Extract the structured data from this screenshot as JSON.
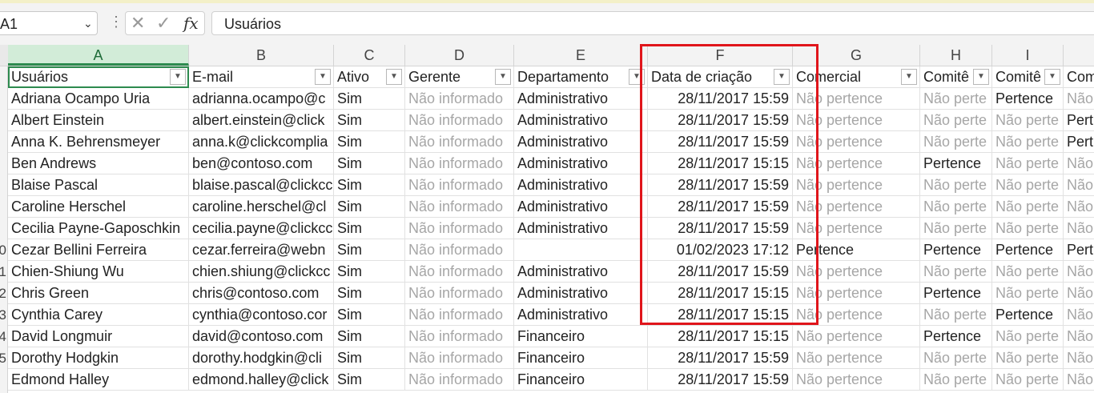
{
  "formula_bar": {
    "name_box": "A1",
    "cancel_glyph": "✕",
    "enter_glyph": "✓",
    "fx_label": "fx",
    "formula_value": "Usuários"
  },
  "columns": [
    "A",
    "B",
    "C",
    "D",
    "E",
    "F",
    "G",
    "H",
    "I",
    ""
  ],
  "row_numbers": [
    "",
    "",
    "",
    "",
    "",
    "",
    "",
    "",
    "0",
    "1",
    "2",
    "3",
    "4",
    "5"
  ],
  "headers": [
    "Usuários",
    "E-mail",
    "Ativo",
    "Gerente",
    "Departamento",
    "Data de criação",
    "Comercial",
    "Comitê",
    "Comitê",
    "Com"
  ],
  "rows": [
    [
      "Adriana Ocampo Uria",
      "adrianna.ocampo@c",
      "Sim",
      "Não informado",
      "Administrativo",
      "28/11/2017 15:59",
      "Não pertence",
      "Não perte",
      "Pertence",
      "Não"
    ],
    [
      "Albert Einstein",
      "albert.einstein@click",
      "Sim",
      "Não informado",
      "Administrativo",
      "28/11/2017 15:59",
      "Não pertence",
      "Não perte",
      "Não perte",
      "Pert"
    ],
    [
      "Anna K. Behrensmeyer",
      "anna.k@clickcomplia",
      "Sim",
      "Não informado",
      "Administrativo",
      "28/11/2017 15:59",
      "Não pertence",
      "Não perte",
      "Não perte",
      "Pert"
    ],
    [
      "Ben Andrews",
      "ben@contoso.com",
      "Sim",
      "Não informado",
      "Administrativo",
      "28/11/2017 15:15",
      "Não pertence",
      "Pertence",
      "Não perte",
      "Não"
    ],
    [
      "Blaise Pascal",
      "blaise.pascal@clickcc",
      "Sim",
      "Não informado",
      "Administrativo",
      "28/11/2017 15:59",
      "Não pertence",
      "Não perte",
      "Não perte",
      "Não"
    ],
    [
      "Caroline Herschel",
      "caroline.herschel@cl",
      "Sim",
      "Não informado",
      "Administrativo",
      "28/11/2017 15:59",
      "Não pertence",
      "Não perte",
      "Não perte",
      "Não"
    ],
    [
      "Cecilia Payne-Gaposchkin",
      "cecilia.payne@clickcc",
      "Sim",
      "Não informado",
      "Administrativo",
      "28/11/2017 15:59",
      "Não pertence",
      "Não perte",
      "Não perte",
      "Não"
    ],
    [
      "Cezar Bellini  Ferreira",
      "cezar.ferreira@webn",
      "Sim",
      "Não informado",
      "",
      "01/02/2023 17:12",
      "Pertence",
      "Pertence",
      "Pertence",
      "Pert"
    ],
    [
      "Chien-Shiung Wu",
      "chien.shiung@clickcc",
      "Sim",
      "Não informado",
      "Administrativo",
      "28/11/2017 15:59",
      "Não pertence",
      "Não perte",
      "Não perte",
      "Não"
    ],
    [
      "Chris Green",
      "chris@contoso.com",
      "Sim",
      "Não informado",
      "Administrativo",
      "28/11/2017 15:15",
      "Não pertence",
      "Pertence",
      "Não perte",
      "Não"
    ],
    [
      "Cynthia Carey",
      "cynthia@contoso.cor",
      "Sim",
      "Não informado",
      "Administrativo",
      "28/11/2017 15:15",
      "Não pertence",
      "Não perte",
      "Pertence",
      "Não"
    ],
    [
      "David Longmuir",
      "david@contoso.com",
      "Sim",
      "Não informado",
      "Financeiro",
      "28/11/2017 15:15",
      "Não pertence",
      "Pertence",
      "Não perte",
      "Não"
    ],
    [
      "Dorothy Hodgkin",
      "dorothy.hodgkin@cli",
      "Sim",
      "Não informado",
      "Financeiro",
      "28/11/2017 15:59",
      "Não pertence",
      "Não perte",
      "Não perte",
      "Não"
    ],
    [
      "Edmond Halley",
      "edmond.halley@click",
      "Sim",
      "Não informado",
      "Financeiro",
      "28/11/2017 15:59",
      "Não pertence",
      "Não perte",
      "Não perte",
      "Não"
    ]
  ],
  "colors": {
    "selected_column_fill": "#d2ecd8",
    "selected_column_accent": "#2d8a4e",
    "highlight_box": "#e0151b",
    "muted_text": "#a6a6a6"
  }
}
